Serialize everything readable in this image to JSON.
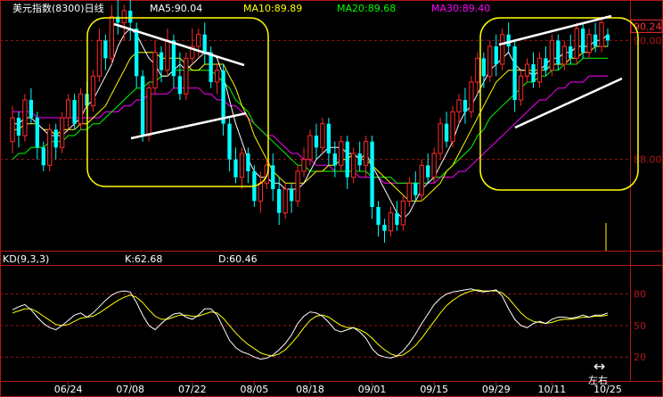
{
  "chart_data": [
    {
      "type": "candlestick",
      "title": "美元指数(8300)日线",
      "indicators": [
        {
          "name": "MA5:90.04",
          "color": "#ffffff"
        },
        {
          "name": "MA10:89.89",
          "color": "#ffff00"
        },
        {
          "name": "MA20:89.68",
          "color": "#00ff00"
        },
        {
          "name": "MA30:89.40",
          "color": "#ff00ff"
        }
      ],
      "y_ticks": [
        {
          "label": "90.24",
          "value": 90.24,
          "highlight": true
        },
        {
          "label": "90.00",
          "value": 90.0
        },
        {
          "label": "88.00",
          "value": 88.0
        }
      ],
      "ylim": [
        86.6,
        90.35
      ],
      "x_ticks": [
        {
          "label": "06/24",
          "index": 9
        },
        {
          "label": "07/08",
          "index": 19
        },
        {
          "label": "07/22",
          "index": 29
        },
        {
          "label": "08/05",
          "index": 39
        },
        {
          "label": "08/18",
          "index": 48
        },
        {
          "label": "09/01",
          "index": 58
        },
        {
          "label": "09/15",
          "index": 68
        },
        {
          "label": "09/29",
          "index": 78
        },
        {
          "label": "10/11",
          "index": 87
        },
        {
          "label": "10/25",
          "index": 96
        }
      ],
      "candles": [
        [
          88.3,
          88.7,
          88.9,
          88.1
        ],
        [
          88.7,
          88.4,
          88.8,
          88.2
        ],
        [
          88.4,
          89.0,
          89.1,
          88.3
        ],
        [
          89.0,
          88.7,
          89.2,
          88.6
        ],
        [
          88.7,
          88.2,
          88.8,
          88.0
        ],
        [
          88.2,
          87.9,
          88.3,
          87.8
        ],
        [
          87.9,
          88.5,
          88.6,
          87.8
        ],
        [
          88.5,
          88.2,
          88.6,
          88.0
        ],
        [
          88.2,
          88.7,
          88.8,
          88.1
        ],
        [
          88.7,
          89.0,
          89.1,
          88.5
        ],
        [
          89.0,
          88.6,
          89.1,
          88.5
        ],
        [
          88.6,
          89.1,
          89.2,
          88.5
        ],
        [
          89.1,
          88.9,
          89.3,
          88.7
        ],
        [
          88.9,
          89.4,
          89.5,
          88.8
        ],
        [
          89.4,
          90.0,
          90.2,
          89.3
        ],
        [
          90.0,
          89.7,
          90.1,
          89.5
        ],
        [
          89.7,
          90.4,
          90.6,
          89.6
        ],
        [
          90.4,
          90.3,
          90.8,
          90.1
        ],
        [
          90.3,
          90.5,
          90.6,
          90.0
        ],
        [
          90.5,
          90.3,
          90.9,
          90.0
        ],
        [
          90.2,
          89.4,
          90.3,
          89.2
        ],
        [
          89.4,
          88.4,
          89.5,
          88.3
        ],
        [
          88.4,
          89.2,
          89.3,
          88.3
        ],
        [
          89.2,
          89.8,
          90.0,
          89.1
        ],
        [
          89.8,
          89.5,
          89.9,
          89.3
        ],
        [
          89.5,
          90.0,
          90.2,
          89.4
        ],
        [
          90.0,
          89.4,
          90.1,
          89.2
        ],
        [
          89.4,
          89.1,
          89.8,
          89.0
        ],
        [
          89.1,
          89.7,
          89.8,
          89.0
        ],
        [
          89.7,
          89.9,
          90.2,
          89.6
        ],
        [
          89.9,
          90.1,
          90.2,
          89.7
        ],
        [
          90.1,
          89.8,
          90.3,
          89.6
        ],
        [
          89.8,
          89.3,
          89.9,
          89.2
        ],
        [
          89.3,
          89.5,
          89.6,
          89.1
        ],
        [
          89.5,
          88.6,
          89.6,
          88.4
        ],
        [
          88.6,
          88.0,
          88.7,
          87.8
        ],
        [
          88.0,
          87.7,
          88.2,
          87.6
        ],
        [
          87.7,
          88.1,
          88.2,
          87.5
        ],
        [
          88.1,
          87.8,
          88.2,
          87.6
        ],
        [
          87.8,
          87.3,
          87.9,
          87.2
        ],
        [
          87.3,
          87.6,
          87.8,
          87.1
        ],
        [
          87.6,
          87.9,
          88.0,
          87.5
        ],
        [
          87.9,
          87.5,
          88.1,
          87.3
        ],
        [
          87.5,
          87.1,
          87.7,
          86.9
        ],
        [
          87.1,
          87.5,
          87.6,
          87.0
        ],
        [
          87.5,
          87.3,
          87.6,
          87.1
        ],
        [
          87.3,
          87.8,
          87.9,
          87.2
        ],
        [
          87.8,
          88.0,
          88.2,
          87.7
        ],
        [
          88.0,
          88.4,
          88.5,
          87.9
        ],
        [
          88.4,
          88.2,
          88.6,
          88.0
        ],
        [
          88.2,
          88.6,
          88.7,
          88.1
        ],
        [
          88.6,
          88.1,
          88.7,
          87.9
        ],
        [
          88.1,
          87.9,
          88.3,
          87.7
        ],
        [
          87.9,
          88.3,
          88.4,
          87.8
        ],
        [
          88.3,
          87.7,
          88.4,
          87.5
        ],
        [
          87.7,
          88.1,
          88.2,
          87.6
        ],
        [
          88.1,
          87.9,
          88.3,
          87.8
        ],
        [
          87.9,
          88.3,
          88.4,
          87.7
        ],
        [
          88.3,
          87.2,
          88.4,
          87.0
        ],
        [
          87.2,
          86.9,
          87.3,
          86.7
        ],
        [
          86.9,
          86.8,
          87.0,
          86.6
        ],
        [
          86.8,
          87.1,
          87.2,
          86.7
        ],
        [
          87.1,
          86.9,
          87.3,
          86.8
        ],
        [
          86.9,
          87.3,
          87.4,
          86.8
        ],
        [
          87.3,
          87.6,
          87.7,
          87.2
        ],
        [
          87.6,
          87.4,
          87.8,
          87.3
        ],
        [
          87.4,
          87.9,
          88.0,
          87.3
        ],
        [
          87.9,
          87.7,
          88.1,
          87.6
        ],
        [
          87.7,
          88.1,
          88.2,
          87.6
        ],
        [
          88.1,
          88.6,
          88.7,
          88.0
        ],
        [
          88.6,
          88.3,
          88.8,
          88.2
        ],
        [
          88.3,
          88.8,
          88.9,
          88.2
        ],
        [
          88.8,
          89.0,
          89.1,
          88.6
        ],
        [
          89.0,
          88.8,
          89.2,
          88.6
        ],
        [
          88.8,
          89.3,
          89.4,
          88.7
        ],
        [
          89.3,
          89.7,
          89.8,
          89.1
        ],
        [
          89.7,
          89.4,
          89.8,
          89.2
        ],
        [
          89.4,
          89.9,
          90.0,
          89.3
        ],
        [
          89.9,
          89.6,
          90.1,
          89.4
        ],
        [
          89.6,
          90.1,
          90.2,
          89.5
        ],
        [
          90.1,
          89.9,
          90.3,
          89.8
        ],
        [
          89.9,
          89.0,
          90.0,
          88.8
        ],
        [
          89.0,
          89.4,
          89.5,
          88.9
        ],
        [
          89.4,
          89.6,
          89.7,
          89.3
        ],
        [
          89.6,
          89.3,
          89.8,
          89.2
        ],
        [
          89.3,
          89.7,
          89.8,
          89.2
        ],
        [
          89.7,
          89.5,
          89.9,
          89.4
        ],
        [
          89.5,
          90.0,
          90.1,
          89.4
        ],
        [
          90.0,
          89.6,
          90.1,
          89.5
        ],
        [
          89.6,
          89.9,
          90.0,
          89.5
        ],
        [
          89.9,
          89.7,
          90.1,
          89.6
        ],
        [
          89.7,
          90.2,
          90.3,
          89.6
        ],
        [
          90.2,
          89.8,
          90.3,
          89.7
        ],
        [
          89.8,
          90.1,
          90.2,
          89.7
        ],
        [
          90.1,
          89.9,
          90.3,
          89.8
        ],
        [
          89.9,
          90.3,
          90.4,
          89.8
        ],
        [
          90.1,
          90.0,
          90.2,
          89.9
        ]
      ],
      "ma5": [
        88.6,
        88.6,
        88.7,
        88.7,
        88.6,
        88.5,
        88.4,
        88.4,
        88.4,
        88.5,
        88.6,
        88.7,
        88.9,
        89.0,
        89.2,
        89.4,
        89.6,
        89.9,
        90.1,
        90.2,
        90.1,
        89.9,
        89.7,
        89.6,
        89.4,
        89.4,
        89.5,
        89.6,
        89.5,
        89.6,
        89.7,
        89.8,
        89.8,
        89.7,
        89.4,
        89.0,
        88.6,
        88.3,
        88.0,
        87.8,
        87.7,
        87.7,
        87.6,
        87.6,
        87.5,
        87.5,
        87.5,
        87.6,
        87.8,
        88.0,
        88.1,
        88.2,
        88.2,
        88.2,
        88.1,
        88.1,
        88.0,
        88.1,
        87.9,
        87.7,
        87.5,
        87.3,
        87.1,
        87.0,
        87.1,
        87.3,
        87.5,
        87.6,
        87.7,
        87.9,
        88.1,
        88.3,
        88.6,
        88.8,
        88.9,
        89.1,
        89.3,
        89.5,
        89.6,
        89.7,
        89.8,
        89.6,
        89.5,
        89.5,
        89.4,
        89.5,
        89.6,
        89.7,
        89.7,
        89.8,
        89.8,
        89.9,
        89.9,
        89.9,
        90.0,
        90.0,
        90.1
      ],
      "ma10": [
        88.5,
        88.5,
        88.6,
        88.6,
        88.6,
        88.5,
        88.5,
        88.4,
        88.5,
        88.5,
        88.5,
        88.6,
        88.6,
        88.7,
        88.8,
        88.9,
        89.1,
        89.3,
        89.5,
        89.7,
        89.8,
        89.8,
        89.8,
        89.8,
        89.7,
        89.7,
        89.7,
        89.7,
        89.6,
        89.5,
        89.5,
        89.6,
        89.6,
        89.6,
        89.6,
        89.4,
        89.2,
        88.9,
        88.7,
        88.4,
        88.2,
        88.0,
        87.8,
        87.7,
        87.6,
        87.6,
        87.6,
        87.6,
        87.7,
        87.8,
        87.8,
        87.9,
        87.9,
        88.0,
        88.0,
        88.1,
        88.0,
        88.0,
        87.9,
        87.8,
        87.7,
        87.6,
        87.5,
        87.4,
        87.3,
        87.3,
        87.3,
        87.4,
        87.5,
        87.6,
        87.8,
        87.9,
        88.1,
        88.3,
        88.5,
        88.7,
        88.9,
        89.1,
        89.3,
        89.4,
        89.5,
        89.5,
        89.5,
        89.5,
        89.5,
        89.5,
        89.5,
        89.6,
        89.6,
        89.6,
        89.7,
        89.7,
        89.8,
        89.8,
        89.9,
        89.9,
        89.9
      ],
      "ma20": [
        88.0,
        88.1,
        88.1,
        88.2,
        88.2,
        88.2,
        88.3,
        88.3,
        88.3,
        88.4,
        88.4,
        88.5,
        88.5,
        88.6,
        88.6,
        88.7,
        88.8,
        88.9,
        89.0,
        89.1,
        89.2,
        89.2,
        89.3,
        89.3,
        89.4,
        89.4,
        89.5,
        89.5,
        89.5,
        89.5,
        89.5,
        89.5,
        89.5,
        89.4,
        89.3,
        89.2,
        89.0,
        88.9,
        88.8,
        88.6,
        88.5,
        88.4,
        88.3,
        88.2,
        88.1,
        88.0,
        87.9,
        87.9,
        87.8,
        87.8,
        87.8,
        87.8,
        87.8,
        87.8,
        87.8,
        87.8,
        87.8,
        87.8,
        87.7,
        87.7,
        87.7,
        87.7,
        87.6,
        87.6,
        87.6,
        87.6,
        87.6,
        87.6,
        87.7,
        87.7,
        87.8,
        87.9,
        88.0,
        88.1,
        88.2,
        88.4,
        88.5,
        88.7,
        88.8,
        88.9,
        89.0,
        89.1,
        89.2,
        89.3,
        89.3,
        89.4,
        89.4,
        89.5,
        89.5,
        89.6,
        89.6,
        89.6,
        89.7,
        89.7,
        89.7,
        89.7,
        89.7
      ],
      "ma30": [
        88.8,
        88.8,
        88.8,
        88.8,
        88.7,
        88.7,
        88.7,
        88.7,
        88.7,
        88.7,
        88.7,
        88.7,
        88.7,
        88.7,
        88.7,
        88.8,
        88.8,
        88.8,
        88.9,
        88.9,
        89.0,
        89.0,
        89.1,
        89.1,
        89.1,
        89.1,
        89.2,
        89.2,
        89.2,
        89.2,
        89.2,
        89.1,
        89.1,
        89.0,
        89.0,
        88.9,
        88.9,
        88.8,
        88.7,
        88.6,
        88.5,
        88.4,
        88.4,
        88.3,
        88.2,
        88.1,
        88.1,
        88.0,
        88.0,
        87.9,
        87.9,
        87.9,
        87.8,
        87.8,
        87.8,
        87.8,
        87.7,
        87.7,
        87.7,
        87.7,
        87.6,
        87.6,
        87.6,
        87.6,
        87.6,
        87.6,
        87.6,
        87.6,
        87.6,
        87.7,
        87.7,
        87.7,
        87.8,
        87.8,
        87.9,
        88.0,
        88.1,
        88.2,
        88.3,
        88.4,
        88.5,
        88.6,
        88.7,
        88.8,
        88.9,
        89.0,
        89.0,
        89.1,
        89.2,
        89.2,
        89.3,
        89.3,
        89.3,
        89.4,
        89.4,
        89.4,
        89.4
      ]
    },
    {
      "type": "line",
      "title": "KD(9,3,3)",
      "ylim": [
        10,
        95
      ],
      "y_ticks": [
        {
          "label": "80",
          "value": 80
        },
        {
          "label": "50",
          "value": 50
        },
        {
          "label": "20",
          "value": 20
        }
      ],
      "series": [
        {
          "name": "K:62.68",
          "color": "#ffffff",
          "values": [
            65,
            68,
            70,
            65,
            58,
            52,
            48,
            46,
            50,
            55,
            60,
            62,
            58,
            62,
            68,
            74,
            79,
            82,
            83,
            82,
            72,
            60,
            50,
            46,
            52,
            57,
            61,
            62,
            58,
            56,
            60,
            66,
            66,
            60,
            48,
            36,
            29,
            25,
            23,
            20,
            18,
            19,
            22,
            27,
            33,
            41,
            52,
            59,
            63,
            62,
            59,
            53,
            46,
            44,
            46,
            48,
            44,
            38,
            28,
            22,
            20,
            19,
            21,
            26,
            33,
            42,
            52,
            61,
            70,
            76,
            80,
            82,
            83,
            84,
            85,
            83,
            82,
            83,
            84,
            78,
            66,
            56,
            50,
            48,
            52,
            54,
            52,
            56,
            58,
            58,
            57,
            58,
            60,
            58,
            60,
            60,
            62
          ]
        },
        {
          "name": "D:60.46",
          "color": "#ffff00",
          "values": [
            62,
            64,
            66,
            66,
            63,
            59,
            55,
            51,
            50,
            51,
            54,
            57,
            58,
            59,
            62,
            66,
            70,
            74,
            77,
            79,
            77,
            72,
            65,
            59,
            56,
            56,
            58,
            60,
            60,
            59,
            59,
            61,
            63,
            62,
            57,
            50,
            43,
            37,
            32,
            28,
            24,
            22,
            21,
            23,
            27,
            33,
            40,
            48,
            55,
            59,
            60,
            58,
            54,
            50,
            48,
            48,
            46,
            43,
            38,
            32,
            27,
            23,
            21,
            22,
            26,
            31,
            38,
            46,
            54,
            62,
            69,
            74,
            78,
            81,
            83,
            84,
            83,
            83,
            83,
            81,
            76,
            69,
            62,
            57,
            54,
            53,
            52,
            53,
            55,
            56,
            56,
            57,
            58,
            58,
            59,
            59,
            60
          ]
        }
      ]
    }
  ],
  "highlight_color": "#ffff00",
  "trendline_color": "#ffffff",
  "icon": {
    "name": "resize-arrows-icon",
    "glyph": "↔"
  },
  "footer_text": "左右"
}
